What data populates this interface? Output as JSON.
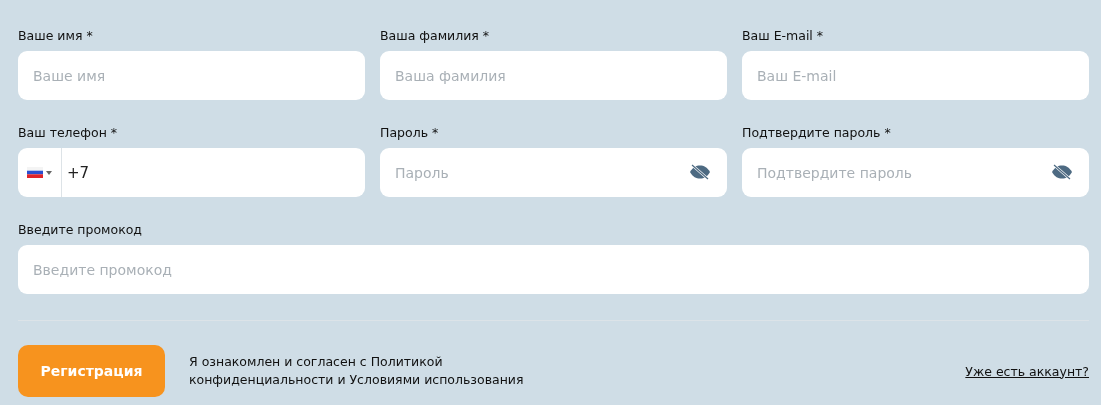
{
  "fields": [
    {
      "kind": "text",
      "label": "Ваше имя *",
      "placeholder": "Ваше имя",
      "wide": false
    },
    {
      "kind": "text",
      "label": "Ваша фамилия *",
      "placeholder": "Ваша фамилия",
      "wide": false
    },
    {
      "kind": "text",
      "label": "Ваш E-mail *",
      "placeholder": "Ваш E-mail",
      "wide": false
    },
    {
      "kind": "phone",
      "label": "Ваш телефон *",
      "value": "+7",
      "wide": false
    },
    {
      "kind": "password",
      "label": "Пароль *",
      "placeholder": "Пароль",
      "wide": false
    },
    {
      "kind": "password",
      "label": "Подтвердите пароль *",
      "placeholder": "Подтвердите пароль",
      "wide": false
    },
    {
      "kind": "text",
      "label": "Введите промокод",
      "placeholder": "Введите промокод",
      "wide": true
    }
  ],
  "submit_button": "Регистрация",
  "consent": "Я ознакомлен и согласен с  Политикой конфиденциальности и  Условиями использования",
  "login_link": "Уже есть аккаунт?"
}
